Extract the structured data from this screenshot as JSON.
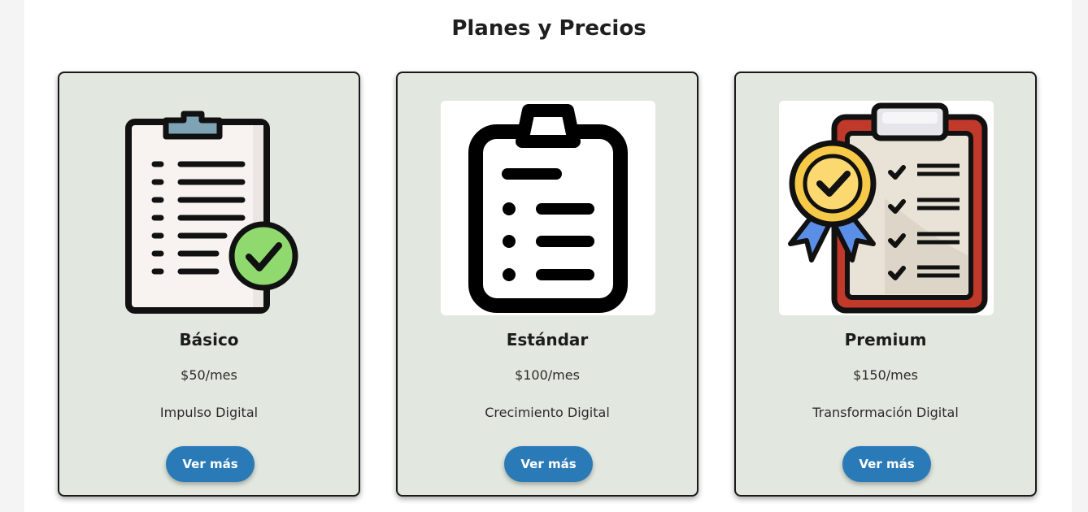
{
  "section_title": "Planes y Precios",
  "plans": [
    {
      "name": "Básico",
      "price": "$50/mes",
      "description": "Impulso Digital",
      "button_label": "Ver más",
      "icon": "clipboard-check-icon"
    },
    {
      "name": "Estándar",
      "price": "$100/mes",
      "description": "Crecimiento Digital",
      "button_label": "Ver más",
      "icon": "clipboard-list-icon"
    },
    {
      "name": "Premium",
      "price": "$150/mes",
      "description": "Transformación Digital",
      "button_label": "Ver más",
      "icon": "clipboard-award-icon"
    }
  ],
  "colors": {
    "card_background": "#e2e8df",
    "button": "#2a7ab8",
    "check_green": "#8fd96e",
    "award_gold": "#f7c948",
    "ribbon_blue": "#5b8ee6",
    "clipboard_red": "#c0392b"
  }
}
